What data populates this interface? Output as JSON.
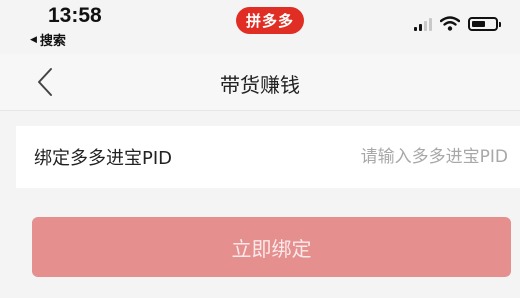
{
  "status_bar": {
    "time": "13:58",
    "back_app_label": "搜索",
    "app_badge": "拼多多"
  },
  "nav": {
    "title": "带货赚钱"
  },
  "form": {
    "pid_label": "绑定多多进宝PID",
    "pid_placeholder": "请输入多多进宝PID",
    "pid_value": ""
  },
  "actions": {
    "bind_label": "立即绑定"
  },
  "colors": {
    "brand_red": "#e02e24",
    "button_bg_disabled": "#e58f8f",
    "page_bg": "#f4f4f4"
  },
  "icons": {
    "back": "chevron-left-icon",
    "signal": "cellular-signal-icon",
    "wifi": "wifi-icon",
    "battery": "battery-icon"
  }
}
